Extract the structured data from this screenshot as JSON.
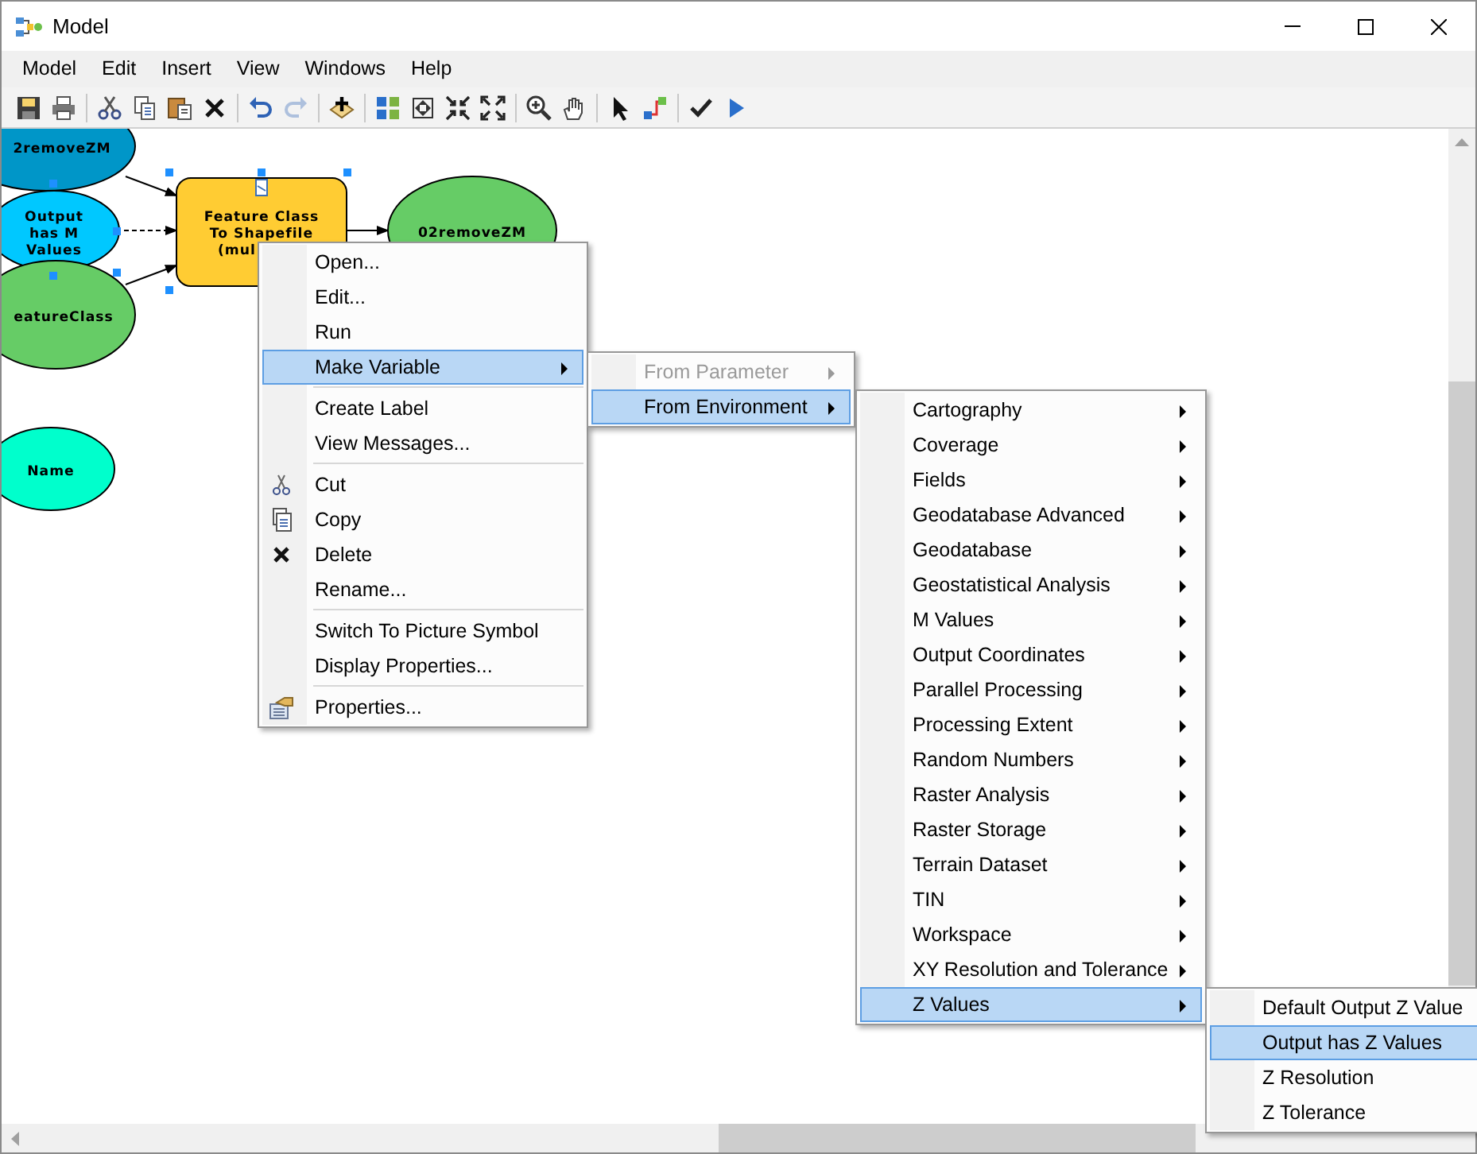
{
  "window": {
    "title": "Model"
  },
  "menubar": [
    "Model",
    "Edit",
    "Insert",
    "View",
    "Windows",
    "Help"
  ],
  "toolbar": [
    {
      "disabled": false
    },
    {
      "disabled": false
    },
    {
      "disabled": false
    },
    {
      "disabled": false
    },
    {
      "disabled": false
    },
    {
      "disabled": false
    },
    {
      "disabled": false
    },
    {
      "disabled": true
    },
    {
      "disabled": false
    },
    {
      "disabled": false
    },
    {
      "disabled": false
    },
    {
      "disabled": false
    },
    {
      "disabled": false
    },
    {
      "disabled": false
    },
    {
      "disabled": false
    },
    {
      "disabled": false
    },
    {
      "disabled": false
    },
    {
      "disabled": false
    },
    {
      "disabled": false
    }
  ],
  "diagram": {
    "nodes": [
      {
        "kind": "ellipse",
        "lines": [
          "2removeZM"
        ],
        "color": "#0096c8"
      },
      {
        "kind": "ellipse",
        "lines": [
          "Output",
          "has M",
          "Values"
        ],
        "color": "#00c8ff"
      },
      {
        "kind": "ellipse",
        "lines": [
          "eatureClass"
        ],
        "color": "#66cc66"
      },
      {
        "kind": "ellipse",
        "lines": [
          "Name"
        ],
        "color": "#00ffcc"
      },
      {
        "kind": "tool",
        "lines": [
          "Feature Class",
          "To Shapefile",
          "(mul"
        ],
        "color": "#ffcc33"
      },
      {
        "kind": "ellipse",
        "lines": [
          "02removeZM"
        ],
        "color": "#66cc66"
      }
    ]
  },
  "context_menu": [
    {
      "label": "Open...",
      "selected": false
    },
    {
      "label": "Edit...",
      "selected": false
    },
    {
      "label": "Run",
      "selected": false
    },
    {
      "label": "Make Variable",
      "selected": true,
      "submenu": true
    },
    {
      "label": "Create Label",
      "selected": false,
      "separator_before": true
    },
    {
      "label": "View Messages...",
      "selected": false
    },
    {
      "label": "Cut",
      "selected": false,
      "separator_before": true
    },
    {
      "label": "Copy",
      "selected": false
    },
    {
      "label": "Delete",
      "selected": false
    },
    {
      "label": "Rename...",
      "selected": false
    },
    {
      "label": "Switch To Picture Symbol",
      "selected": false,
      "separator_before": true
    },
    {
      "label": "Display Properties...",
      "selected": false
    },
    {
      "label": "Properties...",
      "selected": false,
      "separator_before": true
    }
  ],
  "variable_menu": [
    {
      "label": "From Parameter",
      "selected": false,
      "disabled": true,
      "submenu": true
    },
    {
      "label": "From Environment",
      "selected": true,
      "submenu": true
    }
  ],
  "environment_menu": [
    {
      "label": "Cartography",
      "selected": false
    },
    {
      "label": "Coverage",
      "selected": false
    },
    {
      "label": "Fields",
      "selected": false
    },
    {
      "label": "Geodatabase Advanced",
      "selected": false
    },
    {
      "label": "Geodatabase",
      "selected": false
    },
    {
      "label": "Geostatistical Analysis",
      "selected": false
    },
    {
      "label": "M Values",
      "selected": false
    },
    {
      "label": "Output Coordinates",
      "selected": false
    },
    {
      "label": "Parallel Processing",
      "selected": false
    },
    {
      "label": "Processing Extent",
      "selected": false
    },
    {
      "label": "Random Numbers",
      "selected": false
    },
    {
      "label": "Raster Analysis",
      "selected": false
    },
    {
      "label": "Raster Storage",
      "selected": false
    },
    {
      "label": "Terrain Dataset",
      "selected": false
    },
    {
      "label": "TIN",
      "selected": false
    },
    {
      "label": "Workspace",
      "selected": false
    },
    {
      "label": "XY Resolution and Tolerance",
      "selected": false
    },
    {
      "label": "Z Values",
      "selected": true
    }
  ],
  "z_values_menu": [
    {
      "label": "Default Output Z Value",
      "selected": false
    },
    {
      "label": "Output has Z Values",
      "selected": true
    },
    {
      "label": "Z Resolution",
      "selected": false
    },
    {
      "label": "Z Tolerance",
      "selected": false
    }
  ]
}
